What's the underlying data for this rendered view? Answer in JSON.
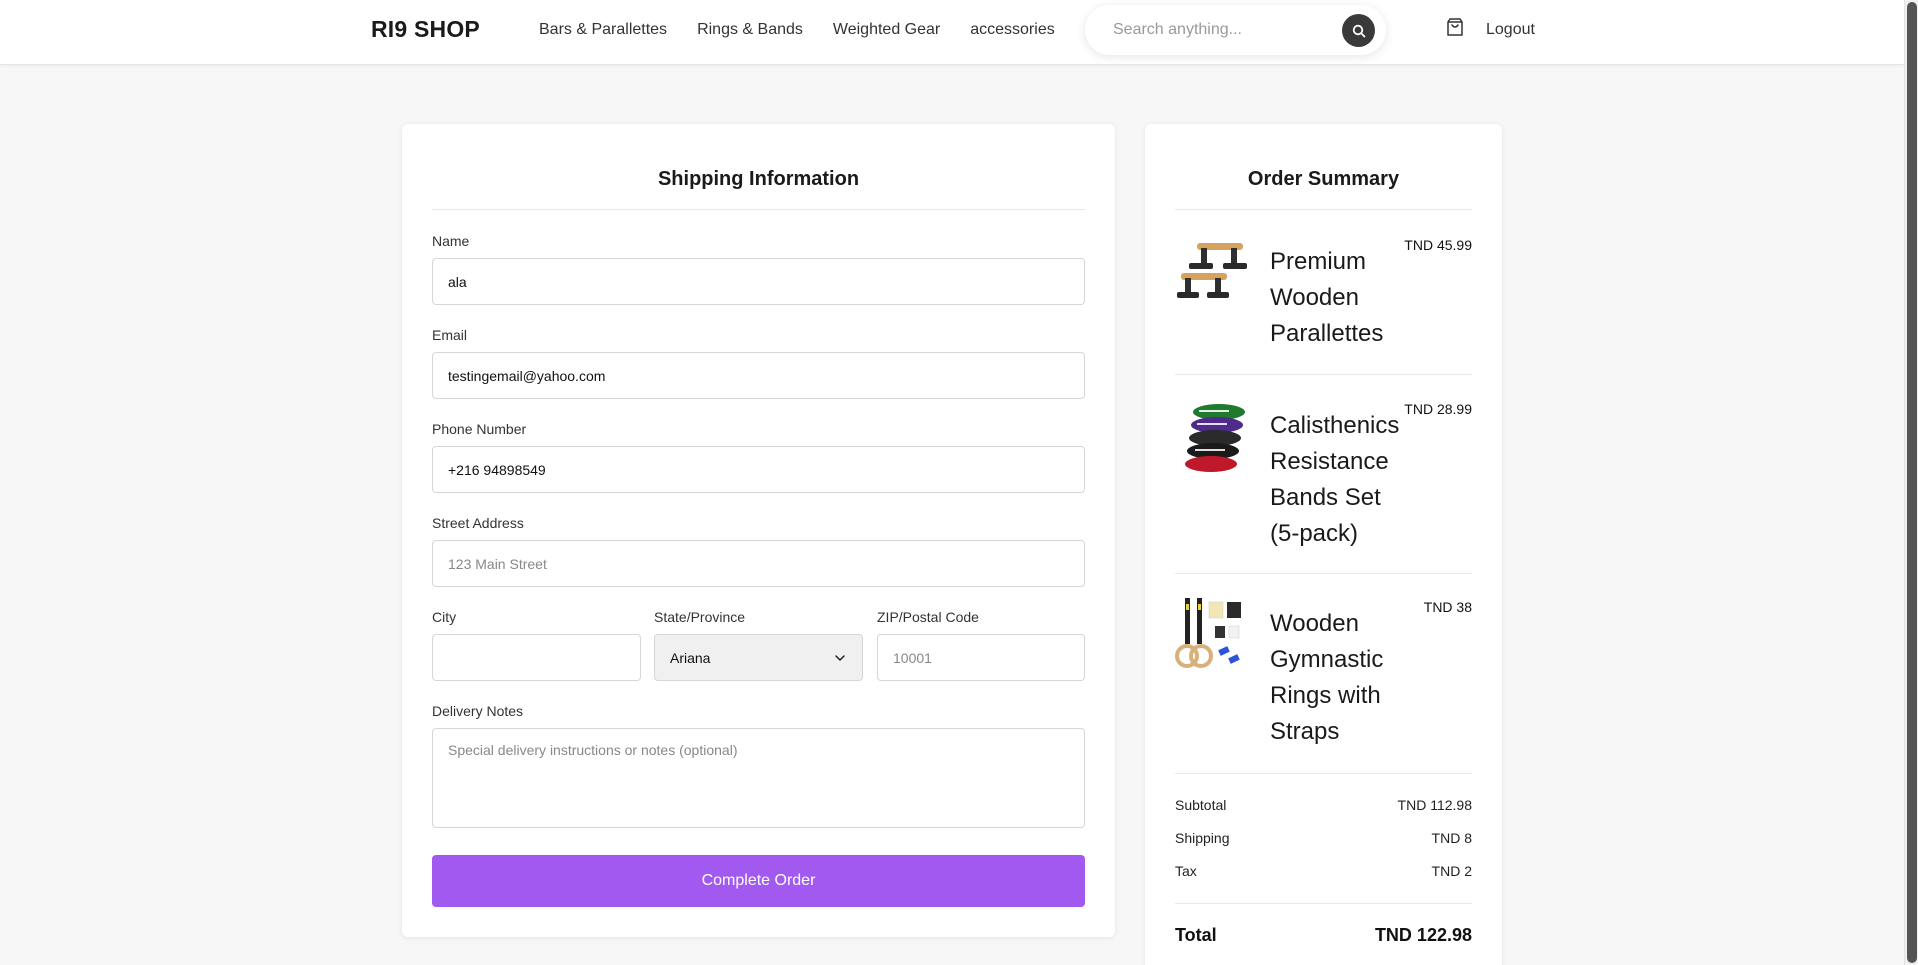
{
  "header": {
    "logo": "RI9 SHOP",
    "nav": [
      "Bars & Parallettes",
      "Rings & Bands",
      "Weighted Gear",
      "accessories"
    ],
    "search_placeholder": "Search anything...",
    "logout": "Logout"
  },
  "shipping": {
    "title": "Shipping Information",
    "name_label": "Name",
    "name_value": "ala",
    "email_label": "Email",
    "email_value": "testingemail@yahoo.com",
    "phone_label": "Phone Number",
    "phone_value": "+216 94898549",
    "street_label": "Street Address",
    "street_placeholder": "123 Main Street",
    "city_label": "City",
    "city_value": "",
    "state_label": "State/Province",
    "state_value": "Ariana",
    "zip_label": "ZIP/Postal Code",
    "zip_placeholder": "10001",
    "notes_label": "Delivery Notes",
    "notes_placeholder": "Special delivery instructions or notes (optional)",
    "submit": "Complete Order"
  },
  "summary": {
    "title": "Order Summary",
    "items": [
      {
        "name": "Premium Wooden Parallettes",
        "price": "TND 45.99"
      },
      {
        "name": "Calisthenics Resistance Bands Set (5-pack)",
        "price": "TND 28.99"
      },
      {
        "name": "Wooden Gymnastic Rings with Straps",
        "price": "TND 38"
      }
    ],
    "subtotal_label": "Subtotal",
    "subtotal": "TND 112.98",
    "shipping_label": "Shipping",
    "shipping": "TND 8",
    "tax_label": "Tax",
    "tax": "TND 2",
    "total_label": "Total",
    "total": "TND 122.98"
  },
  "colors": {
    "accent": "#a259f0",
    "search_button": "#3a3a3a"
  },
  "icons": [
    "search-icon",
    "shopping-bag-icon",
    "chevron-down-icon"
  ]
}
